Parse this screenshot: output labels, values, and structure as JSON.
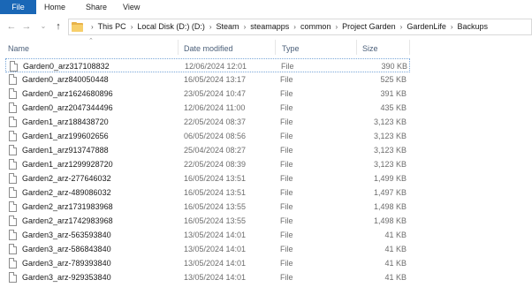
{
  "ribbon": {
    "tabs": [
      "File",
      "Home",
      "Share",
      "View"
    ]
  },
  "address": {
    "crumbs": [
      "This PC",
      "Local Disk (D:) (D:)",
      "Steam",
      "steamapps",
      "common",
      "Project Garden",
      "GardenLife",
      "Backups"
    ]
  },
  "columns": {
    "name": "Name",
    "date": "Date modified",
    "type": "Type",
    "size": "Size"
  },
  "files": [
    {
      "name": "Garden0_arz317108832",
      "date": "12/06/2024 12:01",
      "type": "File",
      "size": "390 KB"
    },
    {
      "name": "Garden0_arz840050448",
      "date": "16/05/2024 13:17",
      "type": "File",
      "size": "525 KB"
    },
    {
      "name": "Garden0_arz1624680896",
      "date": "23/05/2024 10:47",
      "type": "File",
      "size": "391 KB"
    },
    {
      "name": "Garden0_arz2047344496",
      "date": "12/06/2024 11:00",
      "type": "File",
      "size": "435 KB"
    },
    {
      "name": "Garden1_arz188438720",
      "date": "22/05/2024 08:37",
      "type": "File",
      "size": "3,123 KB"
    },
    {
      "name": "Garden1_arz199602656",
      "date": "06/05/2024 08:56",
      "type": "File",
      "size": "3,123 KB"
    },
    {
      "name": "Garden1_arz913747888",
      "date": "25/04/2024 08:27",
      "type": "File",
      "size": "3,123 KB"
    },
    {
      "name": "Garden1_arz1299928720",
      "date": "22/05/2024 08:39",
      "type": "File",
      "size": "3,123 KB"
    },
    {
      "name": "Garden2_arz-277646032",
      "date": "16/05/2024 13:51",
      "type": "File",
      "size": "1,499 KB"
    },
    {
      "name": "Garden2_arz-489086032",
      "date": "16/05/2024 13:51",
      "type": "File",
      "size": "1,497 KB"
    },
    {
      "name": "Garden2_arz1731983968",
      "date": "16/05/2024 13:55",
      "type": "File",
      "size": "1,498 KB"
    },
    {
      "name": "Garden2_arz1742983968",
      "date": "16/05/2024 13:55",
      "type": "File",
      "size": "1,498 KB"
    },
    {
      "name": "Garden3_arz-563593840",
      "date": "13/05/2024 14:01",
      "type": "File",
      "size": "41 KB"
    },
    {
      "name": "Garden3_arz-586843840",
      "date": "13/05/2024 14:01",
      "type": "File",
      "size": "41 KB"
    },
    {
      "name": "Garden3_arz-789393840",
      "date": "13/05/2024 14:01",
      "type": "File",
      "size": "41 KB"
    },
    {
      "name": "Garden3_arz-929353840",
      "date": "13/05/2024 14:01",
      "type": "File",
      "size": "41 KB"
    }
  ]
}
